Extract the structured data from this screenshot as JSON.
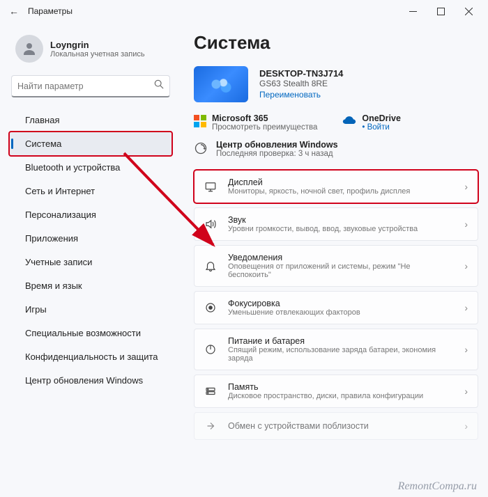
{
  "titlebar": {
    "title": "Параметры"
  },
  "user": {
    "name": "Loyngrin",
    "subtitle": "Локальная учетная запись"
  },
  "search": {
    "placeholder": "Найти параметр"
  },
  "nav": {
    "items": [
      {
        "label": "Главная"
      },
      {
        "label": "Система"
      },
      {
        "label": "Bluetooth и устройства"
      },
      {
        "label": "Сеть и Интернет"
      },
      {
        "label": "Персонализация"
      },
      {
        "label": "Приложения"
      },
      {
        "label": "Учетные записи"
      },
      {
        "label": "Время и язык"
      },
      {
        "label": "Игры"
      },
      {
        "label": "Специальные возможности"
      },
      {
        "label": "Конфиденциальность и защита"
      },
      {
        "label": "Центр обновления Windows"
      }
    ]
  },
  "page": {
    "heading": "Система",
    "device": {
      "name": "DESKTOP-TN3J714",
      "model": "GS63 Stealth 8RE",
      "rename": "Переименовать"
    },
    "ms365": {
      "title": "Microsoft 365",
      "sub": "Просмотреть преимущества"
    },
    "onedrive": {
      "title": "OneDrive",
      "link": "Войти"
    },
    "wu": {
      "title": "Центр обновления Windows",
      "sub": "Последняя проверка: 3 ч назад"
    },
    "items": [
      {
        "title": "Дисплей",
        "sub": "Мониторы, яркость, ночной свет, профиль дисплея"
      },
      {
        "title": "Звук",
        "sub": "Уровни громкости, вывод, ввод, звуковые устройства"
      },
      {
        "title": "Уведомления",
        "sub": "Оповещения от приложений и системы, режим \"Не беспокоить\""
      },
      {
        "title": "Фокусировка",
        "sub": "Уменьшение отвлекающих факторов"
      },
      {
        "title": "Питание и батарея",
        "sub": "Спящий режим, использование заряда батареи, экономия заряда"
      },
      {
        "title": "Память",
        "sub": "Дисковое пространство, диски, правила конфигурации"
      },
      {
        "title": "Обмен с устройствами поблизости",
        "sub": ""
      }
    ]
  },
  "watermark": "RemontCompa.ru"
}
